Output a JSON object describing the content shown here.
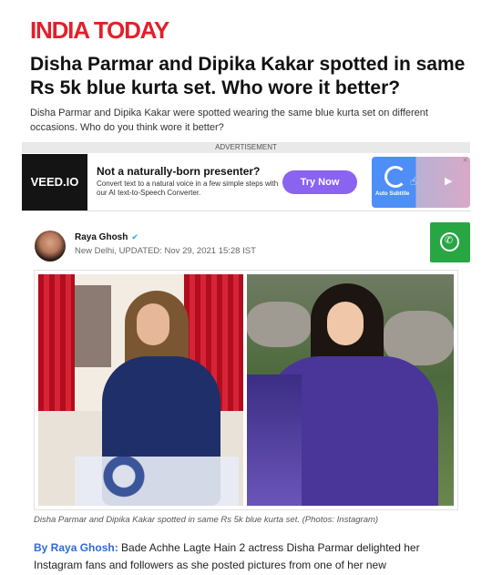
{
  "site": {
    "logo": "INDIA TODAY"
  },
  "article": {
    "headline": "Disha Parmar and Dipika Kakar spotted in same Rs 5k blue kurta set. Who wore it better?",
    "summary": "Disha Parmar and Dipika Kakar were spotted wearing the same blue kurta set on different occasions. Who do you think wore it better?",
    "author_name": "Raya Ghosh",
    "meta": "New Delhi, UPDATED: Nov 29, 2021 15:28 IST",
    "caption": "Disha Parmar and Dipika Kakar spotted in same Rs 5k blue kurta set. (Photos: Instagram)",
    "by_prefix": "By Raya Ghosh:",
    "body": "Bade Achhe Lagte Hain 2 actress Disha Parmar delighted her Instagram fans and followers as she posted pictures from one of her new"
  },
  "ad": {
    "label": "ADVERTISEMENT",
    "brand": "VEED.IO",
    "title": "Not a naturally-born presenter?",
    "subtitle": "Convert text to a natural voice in a few simple steps with our AI text-to-Speech Converter.",
    "cta": "Try Now",
    "visual_label": "Auto Subtitle"
  },
  "colors": {
    "brand_red": "#e2202a",
    "link_blue": "#2e6bd7",
    "whatsapp_green": "#29a644",
    "ad_cta": "#8a63f0"
  },
  "icons": {
    "verified": "verified-badge-icon",
    "whatsapp": "whatsapp-icon",
    "play": "play-icon",
    "cursor": "hand-cursor-icon"
  }
}
